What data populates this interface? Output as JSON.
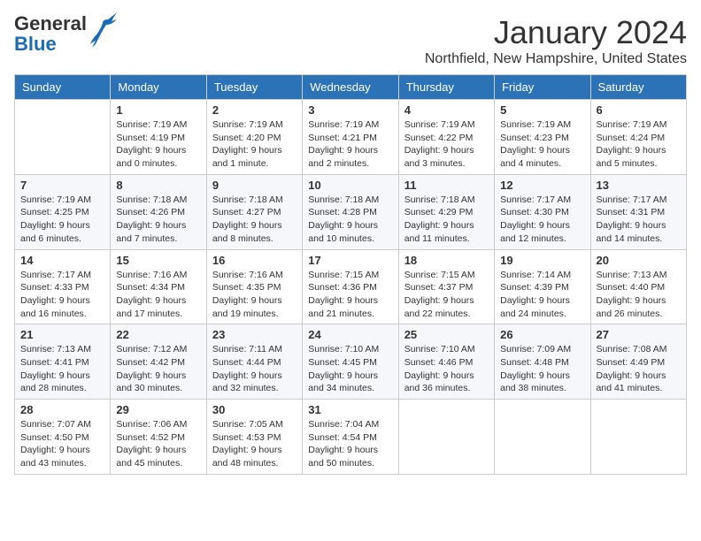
{
  "logo": {
    "general": "General",
    "blue": "Blue"
  },
  "title": "January 2024",
  "location": "Northfield, New Hampshire, United States",
  "days_of_week": [
    "Sunday",
    "Monday",
    "Tuesday",
    "Wednesday",
    "Thursday",
    "Friday",
    "Saturday"
  ],
  "weeks": [
    [
      {
        "day": "",
        "info": ""
      },
      {
        "day": "1",
        "info": "Sunrise: 7:19 AM\nSunset: 4:19 PM\nDaylight: 9 hours\nand 0 minutes."
      },
      {
        "day": "2",
        "info": "Sunrise: 7:19 AM\nSunset: 4:20 PM\nDaylight: 9 hours\nand 1 minute."
      },
      {
        "day": "3",
        "info": "Sunrise: 7:19 AM\nSunset: 4:21 PM\nDaylight: 9 hours\nand 2 minutes."
      },
      {
        "day": "4",
        "info": "Sunrise: 7:19 AM\nSunset: 4:22 PM\nDaylight: 9 hours\nand 3 minutes."
      },
      {
        "day": "5",
        "info": "Sunrise: 7:19 AM\nSunset: 4:23 PM\nDaylight: 9 hours\nand 4 minutes."
      },
      {
        "day": "6",
        "info": "Sunrise: 7:19 AM\nSunset: 4:24 PM\nDaylight: 9 hours\nand 5 minutes."
      }
    ],
    [
      {
        "day": "7",
        "info": "Sunrise: 7:19 AM\nSunset: 4:25 PM\nDaylight: 9 hours\nand 6 minutes."
      },
      {
        "day": "8",
        "info": "Sunrise: 7:18 AM\nSunset: 4:26 PM\nDaylight: 9 hours\nand 7 minutes."
      },
      {
        "day": "9",
        "info": "Sunrise: 7:18 AM\nSunset: 4:27 PM\nDaylight: 9 hours\nand 8 minutes."
      },
      {
        "day": "10",
        "info": "Sunrise: 7:18 AM\nSunset: 4:28 PM\nDaylight: 9 hours\nand 10 minutes."
      },
      {
        "day": "11",
        "info": "Sunrise: 7:18 AM\nSunset: 4:29 PM\nDaylight: 9 hours\nand 11 minutes."
      },
      {
        "day": "12",
        "info": "Sunrise: 7:17 AM\nSunset: 4:30 PM\nDaylight: 9 hours\nand 12 minutes."
      },
      {
        "day": "13",
        "info": "Sunrise: 7:17 AM\nSunset: 4:31 PM\nDaylight: 9 hours\nand 14 minutes."
      }
    ],
    [
      {
        "day": "14",
        "info": "Sunrise: 7:17 AM\nSunset: 4:33 PM\nDaylight: 9 hours\nand 16 minutes."
      },
      {
        "day": "15",
        "info": "Sunrise: 7:16 AM\nSunset: 4:34 PM\nDaylight: 9 hours\nand 17 minutes."
      },
      {
        "day": "16",
        "info": "Sunrise: 7:16 AM\nSunset: 4:35 PM\nDaylight: 9 hours\nand 19 minutes."
      },
      {
        "day": "17",
        "info": "Sunrise: 7:15 AM\nSunset: 4:36 PM\nDaylight: 9 hours\nand 21 minutes."
      },
      {
        "day": "18",
        "info": "Sunrise: 7:15 AM\nSunset: 4:37 PM\nDaylight: 9 hours\nand 22 minutes."
      },
      {
        "day": "19",
        "info": "Sunrise: 7:14 AM\nSunset: 4:39 PM\nDaylight: 9 hours\nand 24 minutes."
      },
      {
        "day": "20",
        "info": "Sunrise: 7:13 AM\nSunset: 4:40 PM\nDaylight: 9 hours\nand 26 minutes."
      }
    ],
    [
      {
        "day": "21",
        "info": "Sunrise: 7:13 AM\nSunset: 4:41 PM\nDaylight: 9 hours\nand 28 minutes."
      },
      {
        "day": "22",
        "info": "Sunrise: 7:12 AM\nSunset: 4:42 PM\nDaylight: 9 hours\nand 30 minutes."
      },
      {
        "day": "23",
        "info": "Sunrise: 7:11 AM\nSunset: 4:44 PM\nDaylight: 9 hours\nand 32 minutes."
      },
      {
        "day": "24",
        "info": "Sunrise: 7:10 AM\nSunset: 4:45 PM\nDaylight: 9 hours\nand 34 minutes."
      },
      {
        "day": "25",
        "info": "Sunrise: 7:10 AM\nSunset: 4:46 PM\nDaylight: 9 hours\nand 36 minutes."
      },
      {
        "day": "26",
        "info": "Sunrise: 7:09 AM\nSunset: 4:48 PM\nDaylight: 9 hours\nand 38 minutes."
      },
      {
        "day": "27",
        "info": "Sunrise: 7:08 AM\nSunset: 4:49 PM\nDaylight: 9 hours\nand 41 minutes."
      }
    ],
    [
      {
        "day": "28",
        "info": "Sunrise: 7:07 AM\nSunset: 4:50 PM\nDaylight: 9 hours\nand 43 minutes."
      },
      {
        "day": "29",
        "info": "Sunrise: 7:06 AM\nSunset: 4:52 PM\nDaylight: 9 hours\nand 45 minutes."
      },
      {
        "day": "30",
        "info": "Sunrise: 7:05 AM\nSunset: 4:53 PM\nDaylight: 9 hours\nand 48 minutes."
      },
      {
        "day": "31",
        "info": "Sunrise: 7:04 AM\nSunset: 4:54 PM\nDaylight: 9 hours\nand 50 minutes."
      },
      {
        "day": "",
        "info": ""
      },
      {
        "day": "",
        "info": ""
      },
      {
        "day": "",
        "info": ""
      }
    ]
  ]
}
